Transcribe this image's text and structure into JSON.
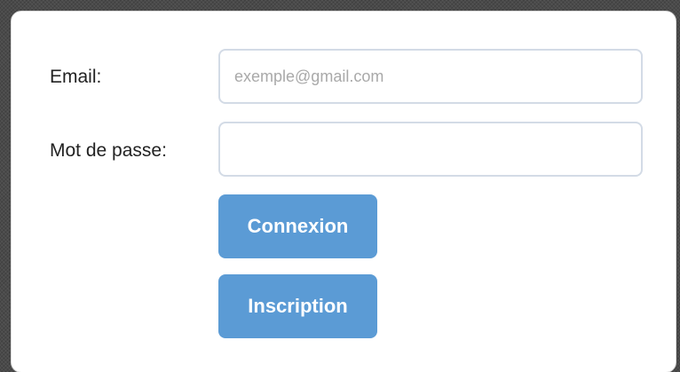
{
  "form": {
    "email_label": "Email:",
    "email_placeholder": "exemple@gmail.com",
    "email_value": "",
    "password_label": "Mot de passe:",
    "password_value": "",
    "login_button": "Connexion",
    "register_button": "Inscription"
  },
  "colors": {
    "button_bg": "#5b9bd5",
    "button_text": "#ffffff",
    "input_border": "#d3dbe6"
  }
}
